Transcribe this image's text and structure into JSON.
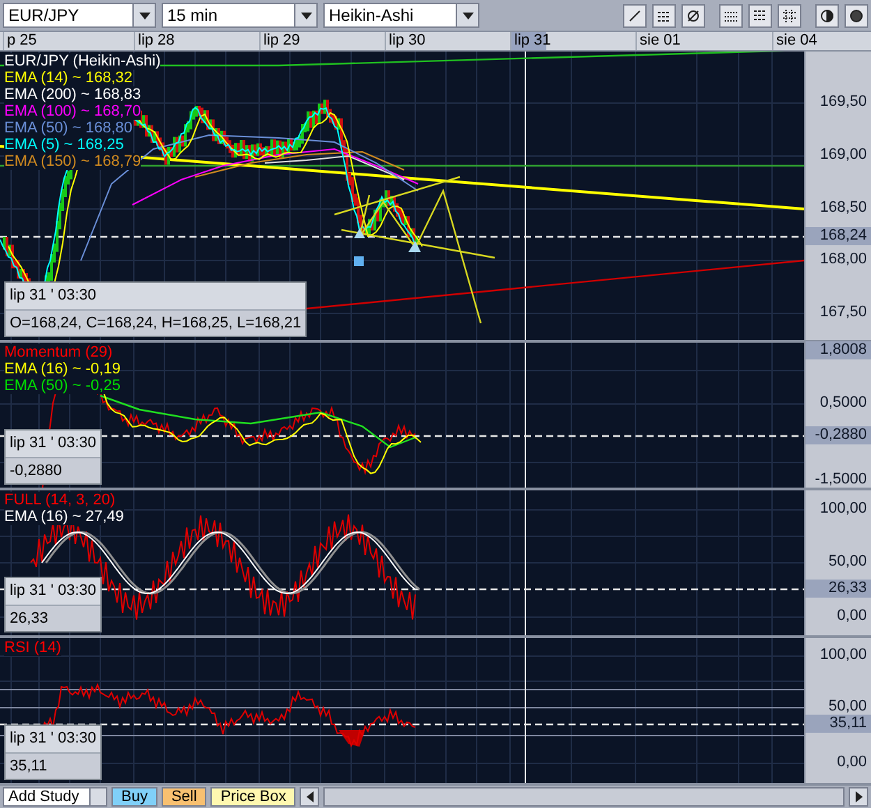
{
  "toolbar": {
    "symbol": "EUR/JPY",
    "interval": "15 min",
    "chart_type": "Heikin-Ashi"
  },
  "date_axis": [
    {
      "label": "p 25",
      "selected": false
    },
    {
      "label": "lip 28",
      "selected": false
    },
    {
      "label": "lip 29",
      "selected": false
    },
    {
      "label": "lip 30",
      "selected": false
    },
    {
      "label": "lip 31",
      "selected": true
    },
    {
      "label": "sie 01",
      "selected": false
    },
    {
      "label": "sie 04",
      "selected": false
    }
  ],
  "panels": [
    {
      "kind": "price",
      "legend": [
        {
          "text": "EUR/JPY (Heikin-Ashi)",
          "color": "#ffffff"
        },
        {
          "text": "EMA (14) ~ 168,32",
          "color": "#ffff00"
        },
        {
          "text": "EMA (200) ~ 168,83",
          "color": "#ffffff"
        },
        {
          "text": "EMA (100) ~ 168,70",
          "color": "#ff00ff"
        },
        {
          "text": "EMA (50) ~ 168,80",
          "color": "#6a8fd8"
        },
        {
          "text": "EMA (5) ~ 168,25",
          "color": "#00ffff"
        },
        {
          "text": "EMA (150) ~ 168,79",
          "color": "#d08a20"
        }
      ],
      "axis": [
        {
          "label": "169,50",
          "kind": "tick"
        },
        {
          "label": "169,00",
          "kind": "tick"
        },
        {
          "label": "168,50",
          "kind": "tick"
        },
        {
          "label": "168,24",
          "kind": "current"
        },
        {
          "label": "168,00",
          "kind": "tick"
        },
        {
          "label": "167,50",
          "kind": "tick"
        }
      ],
      "info": [
        "lip 31 ' 03:30",
        "O=168,24, C=168,24, H=168,25, L=168,21"
      ]
    },
    {
      "kind": "momentum",
      "legend": [
        {
          "text": "Momentum (29)",
          "color": "#ff0000"
        },
        {
          "text": "EMA (16) ~ -0,19",
          "color": "#ffff00"
        },
        {
          "text": "EMA (50) ~ -0,25",
          "color": "#00e000"
        }
      ],
      "axis": [
        {
          "label": "1,8008",
          "kind": "current"
        },
        {
          "label": "0,5000",
          "kind": "tick"
        },
        {
          "label": "-0,2880",
          "kind": "current"
        },
        {
          "label": "-1,5000",
          "kind": "tick"
        }
      ],
      "info": [
        "lip 31 ' 03:30",
        "-0,2880"
      ]
    },
    {
      "kind": "stochastic",
      "legend": [
        {
          "text": "FULL (14, 3, 20)",
          "color": "#ff0000"
        },
        {
          "text": "EMA (16) ~ 27,49",
          "color": "#ffffff"
        }
      ],
      "axis": [
        {
          "label": "100,00",
          "kind": "tick"
        },
        {
          "label": "50,00",
          "kind": "tick"
        },
        {
          "label": "26,33",
          "kind": "current"
        },
        {
          "label": "0,00",
          "kind": "tick"
        }
      ],
      "info": [
        "lip 31 ' 03:30",
        "26,33"
      ]
    },
    {
      "kind": "rsi",
      "legend": [
        {
          "text": "RSI (14)",
          "color": "#ff0000"
        }
      ],
      "axis": [
        {
          "label": "100,00",
          "kind": "tick"
        },
        {
          "label": "50,00",
          "kind": "tick"
        },
        {
          "label": "35,11",
          "kind": "current"
        },
        {
          "label": "0,00",
          "kind": "tick"
        }
      ],
      "info": [
        "lip 31 ' 03:30",
        "35,11"
      ]
    }
  ],
  "bottom_bar": {
    "add_study": "Add Study",
    "buttons": [
      {
        "label": "Buy",
        "color": "#80d0f8"
      },
      {
        "label": "Sell",
        "color": "#f8c070"
      },
      {
        "label": "Price Box",
        "color": "#fff8b0"
      }
    ]
  }
}
